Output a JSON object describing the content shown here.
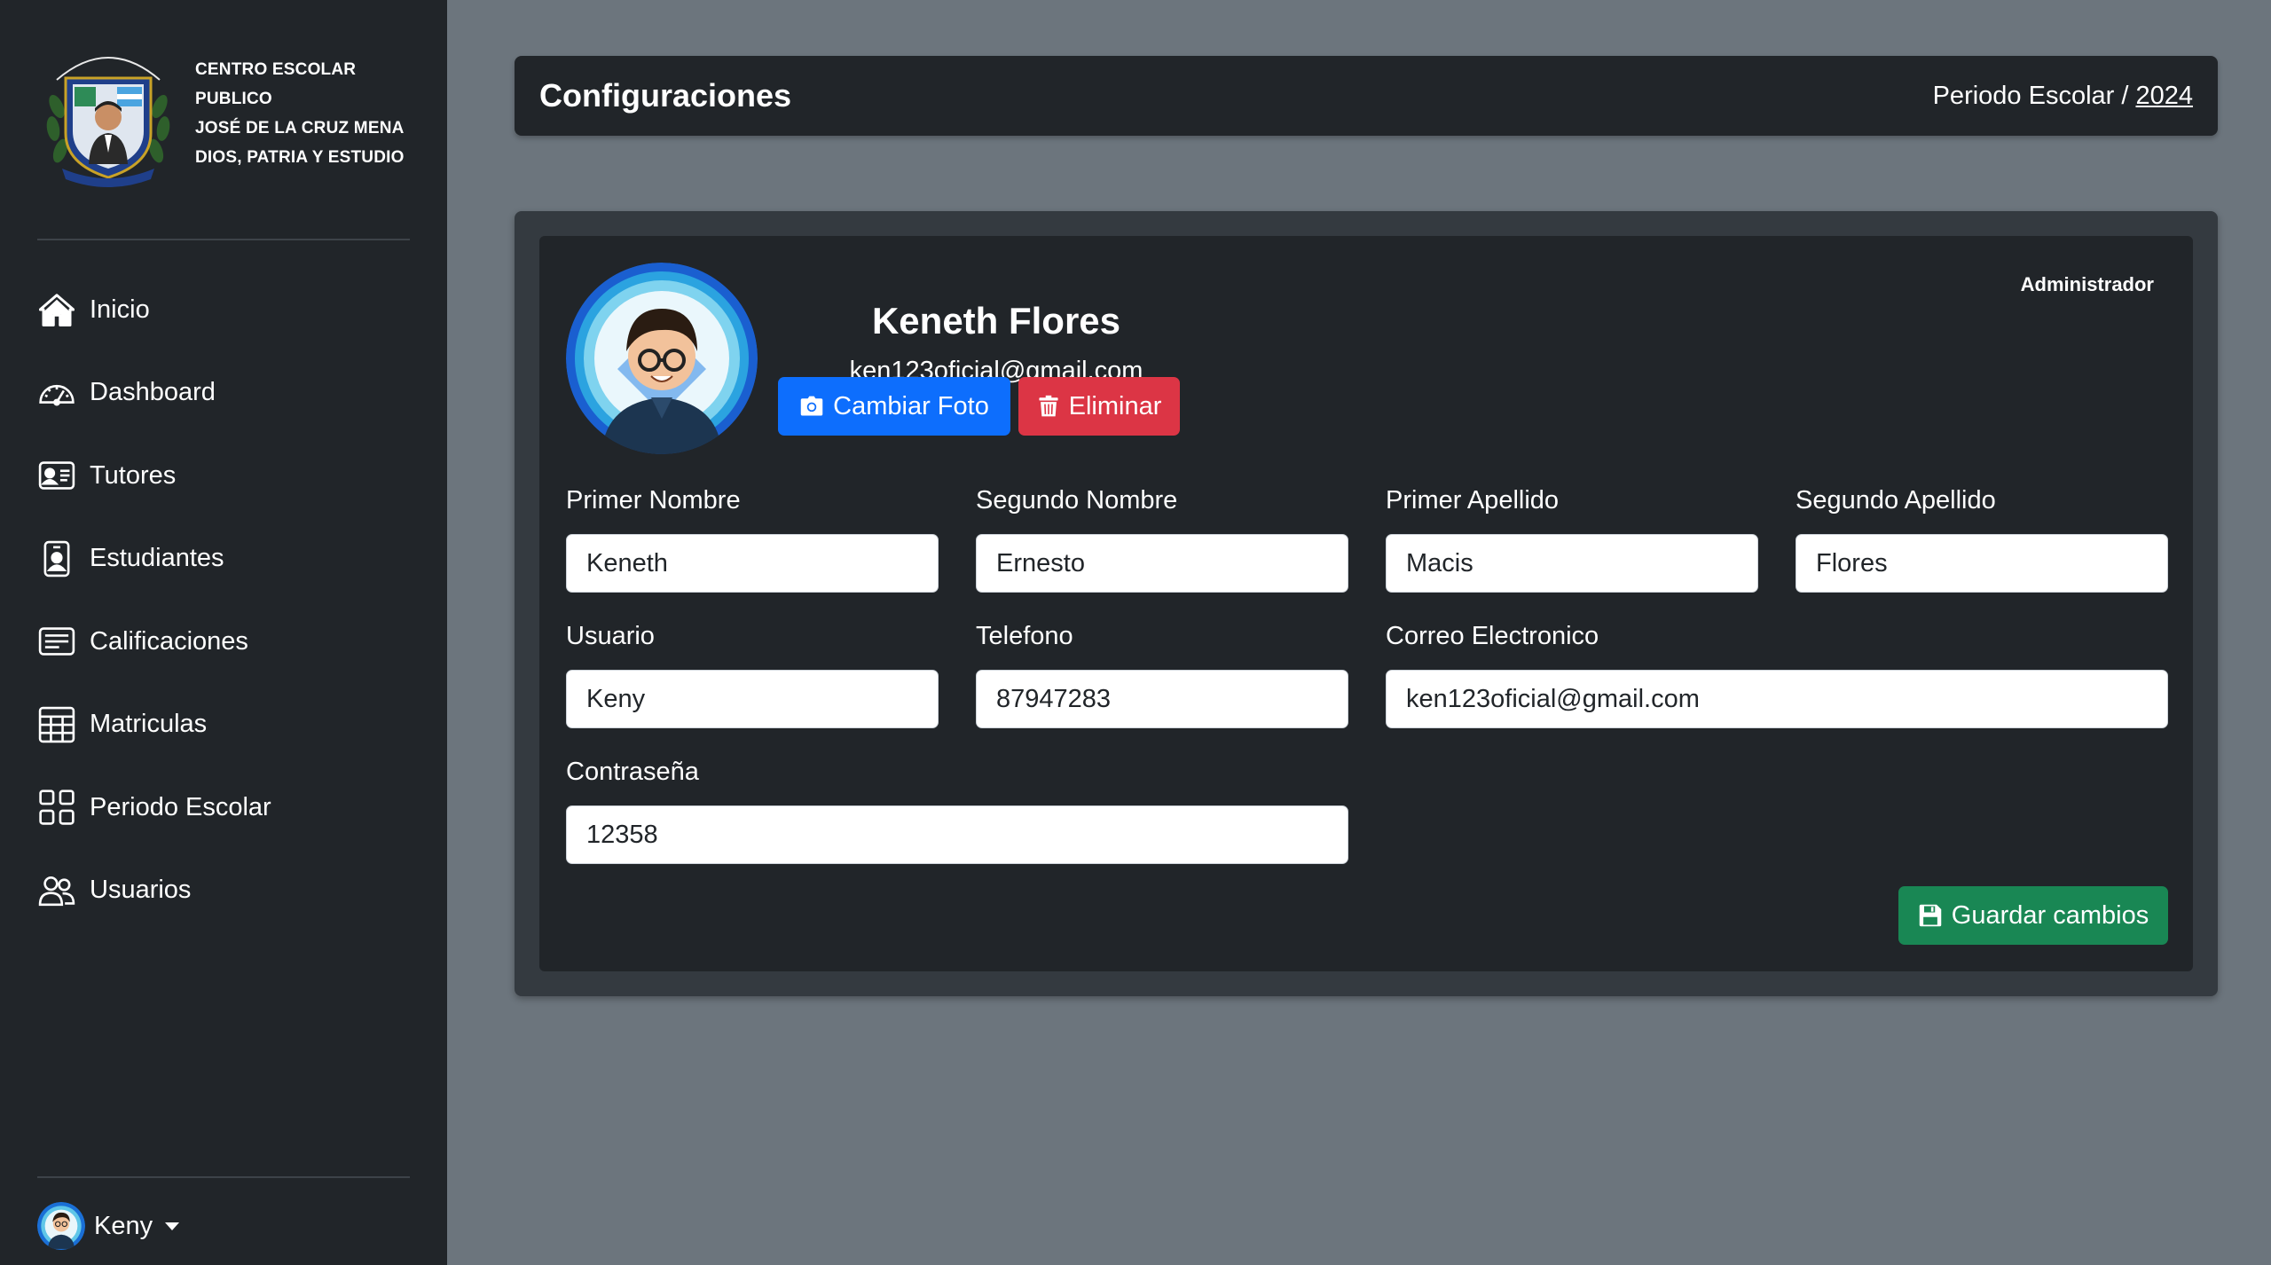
{
  "sidebar": {
    "brand_lines": [
      "CENTRO ESCOLAR PUBLICO",
      "JOSÉ DE LA CRUZ MENA",
      "DIOS, PATRIA Y ESTUDIO"
    ],
    "items": [
      {
        "label": "Inicio",
        "icon": "house-icon"
      },
      {
        "label": "Dashboard",
        "icon": "speedometer-icon"
      },
      {
        "label": "Tutores",
        "icon": "person-vcard-icon"
      },
      {
        "label": "Estudiantes",
        "icon": "person-badge-icon"
      },
      {
        "label": "Calificaciones",
        "icon": "card-text-icon"
      },
      {
        "label": "Matriculas",
        "icon": "table-icon"
      },
      {
        "label": "Periodo Escolar",
        "icon": "grid-icon"
      },
      {
        "label": "Usuarios",
        "icon": "people-icon"
      }
    ],
    "user": {
      "name": "Keny"
    }
  },
  "header": {
    "title": "Configuraciones",
    "period_label": "Periodo Escolar /",
    "period_year": "2024"
  },
  "profile": {
    "full_name": "Keneth Flores",
    "email": "ken123oficial@gmail.com",
    "role": "Administrador",
    "change_photo_label": "Cambiar Foto",
    "delete_label": "Eliminar"
  },
  "form": {
    "first_name_label": "Primer Nombre",
    "first_name": "Keneth",
    "second_name_label": "Segundo Nombre",
    "second_name": "Ernesto",
    "first_surname_label": "Primer Apellido",
    "first_surname": "Macis",
    "second_surname_label": "Segundo Apellido",
    "second_surname": "Flores",
    "username_label": "Usuario",
    "username": "Keny",
    "phone_label": "Telefono",
    "phone": "87947283",
    "email_label": "Correo Electronico",
    "email": "ken123oficial@gmail.com",
    "password_label": "Contraseña",
    "password": "12358",
    "save_label": "Guardar cambios"
  },
  "colors": {
    "sidebar_bg": "#212529",
    "page_bg": "#6c757d",
    "primary": "#0d6efd",
    "danger": "#dc3545",
    "success": "#198754"
  }
}
